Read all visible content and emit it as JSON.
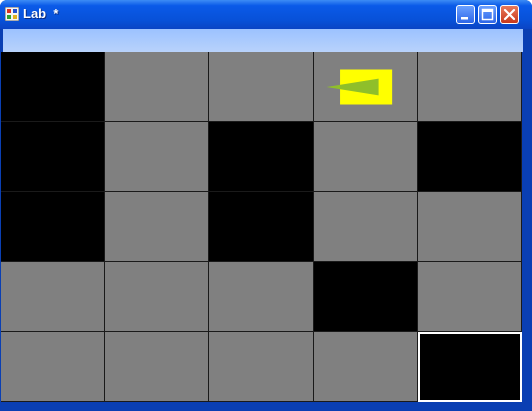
{
  "window": {
    "title": "Lab  *",
    "icon": "app-icon",
    "controls": [
      "minimize-icon",
      "maximize-icon",
      "close-icon"
    ],
    "colors": {
      "titlebar": "#0a5ae8",
      "close": "#c8381c",
      "strip": "#b8d2fb"
    }
  },
  "maze": {
    "rows": 5,
    "cols": 5,
    "legend": {
      "W": "wall",
      "F": "floor",
      "E": "exit"
    },
    "grid": [
      [
        "W",
        "F",
        "F",
        "F",
        "F"
      ],
      [
        "W",
        "F",
        "W",
        "F",
        "W"
      ],
      [
        "W",
        "F",
        "W",
        "F",
        "F"
      ],
      [
        "F",
        "F",
        "F",
        "W",
        "F"
      ],
      [
        "F",
        "F",
        "F",
        "F",
        "E"
      ]
    ],
    "player": {
      "row": 0,
      "col": 3,
      "facing": "left",
      "icon": "player-arrow-icon"
    },
    "colors": {
      "floor": "#808080",
      "wall": "#000000",
      "exit_border": "#ffffff",
      "player_box": "#ffff00",
      "player_arrow": "#8fbf2a"
    }
  }
}
